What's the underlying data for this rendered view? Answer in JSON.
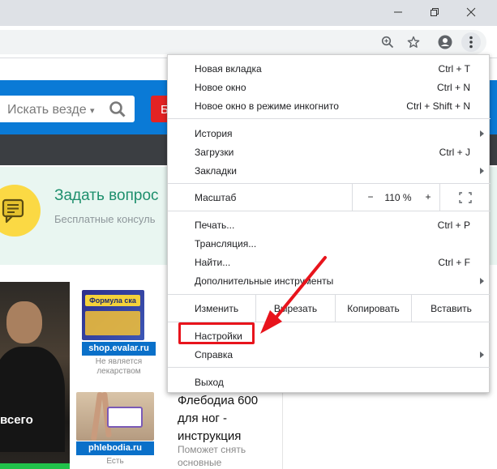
{
  "window": {
    "minimize_icon": "minimize-icon",
    "restore_icon": "restore-icon",
    "close_icon": "close-icon"
  },
  "toolbar": {
    "zoom_icon": "zoom-magnifier-icon",
    "bookmark_icon": "star-icon",
    "profile_icon": "account-circle-icon",
    "menu_icon": "three-dots-vertical-icon"
  },
  "page": {
    "search_placeholder": "Искать везде",
    "search_chevron": "▾",
    "red_button_label": "Б",
    "ask_title": "Задать вопрос",
    "ask_subtitle": "Бесплатные консуль",
    "photo_caption": "всего",
    "ads": [
      {
        "box_label": "Формула ска",
        "link": "shop.evalar.ru",
        "note": "Не является лекарством"
      },
      {
        "link": "phlebodia.ru",
        "note": "Есть"
      }
    ],
    "article_title": "Флебодиа 600 для ног - инструкция",
    "article_subtitle": "Поможет снять основные"
  },
  "menu": {
    "group1": [
      {
        "label": "Новая вкладка",
        "shortcut": "Ctrl + T"
      },
      {
        "label": "Новое окно",
        "shortcut": "Ctrl + N"
      },
      {
        "label": "Новое окно в режиме инкогнито",
        "shortcut": "Ctrl + Shift + N"
      }
    ],
    "group2": [
      {
        "label": "История",
        "shortcut": ""
      },
      {
        "label": "Загрузки",
        "shortcut": "Ctrl + J"
      },
      {
        "label": "Закладки",
        "shortcut": ""
      }
    ],
    "zoom": {
      "label": "Масштаб",
      "minus": "−",
      "value": "110 %",
      "plus": "+",
      "fullscreen_icon": "fullscreen-icon"
    },
    "group3": [
      {
        "label": "Печать...",
        "shortcut": "Ctrl + P"
      },
      {
        "label": "Трансляция...",
        "shortcut": ""
      },
      {
        "label": "Найти...",
        "shortcut": "Ctrl + F"
      },
      {
        "label": "Дополнительные инструменты",
        "shortcut": ""
      }
    ],
    "edit": {
      "label": "Изменить",
      "cut": "Вырезать",
      "copy": "Копировать",
      "paste": "Вставить"
    },
    "group4": [
      {
        "label": "Настройки",
        "shortcut": ""
      },
      {
        "label": "Справка",
        "shortcut": ""
      }
    ],
    "exit": {
      "label": "Выход"
    }
  },
  "annotation": {
    "highlight_color": "#e8141c",
    "arrow_icon": "red-arrow-icon"
  }
}
